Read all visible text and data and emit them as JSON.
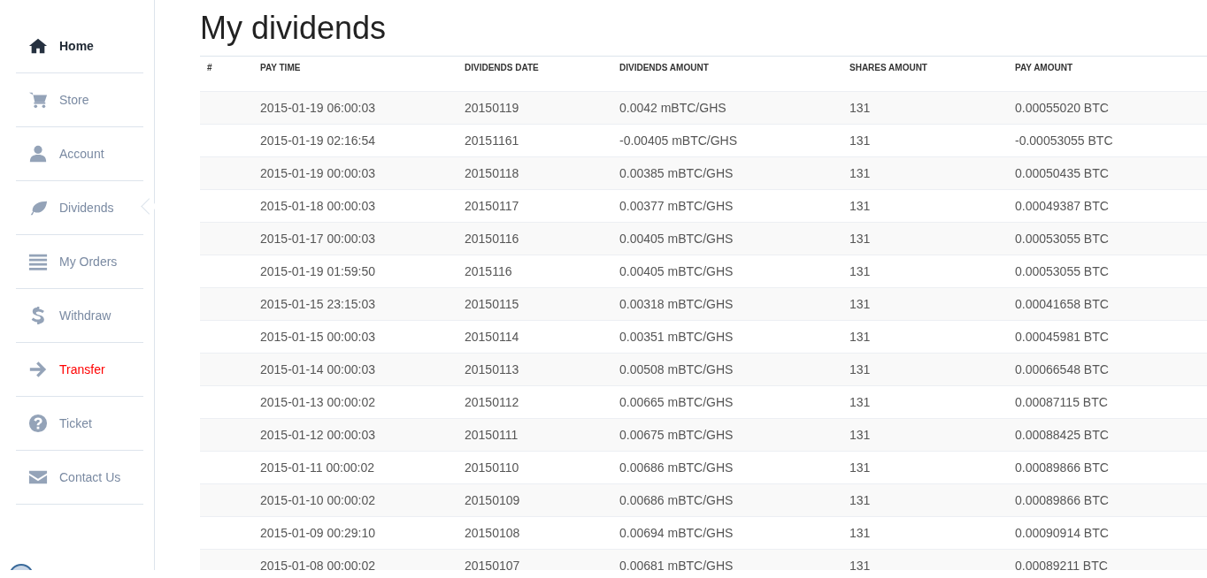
{
  "sidebar": {
    "items": [
      {
        "label": "Home",
        "kind": "strong",
        "selected": false
      },
      {
        "label": "Store",
        "kind": "normal",
        "selected": false
      },
      {
        "label": "Account",
        "kind": "normal",
        "selected": false
      },
      {
        "label": "Dividends",
        "kind": "normal",
        "selected": true
      },
      {
        "label": "My Orders",
        "kind": "normal",
        "selected": false
      },
      {
        "label": "Withdraw",
        "kind": "normal",
        "selected": false
      },
      {
        "label": "Transfer",
        "kind": "alert",
        "selected": false
      },
      {
        "label": "Ticket",
        "kind": "normal",
        "selected": false
      },
      {
        "label": "Contact Us",
        "kind": "normal",
        "selected": false
      }
    ]
  },
  "page": {
    "title": "My dividends"
  },
  "table": {
    "columns": [
      "#",
      "PAY TIME",
      "DIVIDENDS DATE",
      "DIVIDENDS AMOUNT",
      "SHARES AMOUNT",
      "PAY AMOUNT"
    ],
    "rows": [
      [
        "",
        "2015-01-19 06:00:03",
        "20150119",
        "0.0042 mBTC/GHS",
        "131",
        "0.00055020 BTC"
      ],
      [
        "",
        "2015-01-19 02:16:54",
        "20151161",
        "-0.00405 mBTC/GHS",
        "131",
        "-0.00053055 BTC"
      ],
      [
        "",
        "2015-01-19 00:00:03",
        "20150118",
        "0.00385 mBTC/GHS",
        "131",
        "0.00050435 BTC"
      ],
      [
        "",
        "2015-01-18 00:00:03",
        "20150117",
        "0.00377 mBTC/GHS",
        "131",
        "0.00049387 BTC"
      ],
      [
        "",
        "2015-01-17 00:00:03",
        "20150116",
        "0.00405 mBTC/GHS",
        "131",
        "0.00053055 BTC"
      ],
      [
        "",
        "2015-01-19 01:59:50",
        "2015116",
        "0.00405 mBTC/GHS",
        "131",
        "0.00053055 BTC"
      ],
      [
        "",
        "2015-01-15 23:15:03",
        "20150115",
        "0.00318 mBTC/GHS",
        "131",
        "0.00041658 BTC"
      ],
      [
        "",
        "2015-01-15 00:00:03",
        "20150114",
        "0.00351 mBTC/GHS",
        "131",
        "0.00045981 BTC"
      ],
      [
        "",
        "2015-01-14 00:00:03",
        "20150113",
        "0.00508 mBTC/GHS",
        "131",
        "0.00066548 BTC"
      ],
      [
        "",
        "2015-01-13 00:00:02",
        "20150112",
        "0.00665 mBTC/GHS",
        "131",
        "0.00087115 BTC"
      ],
      [
        "",
        "2015-01-12 00:00:03",
        "20150111",
        "0.00675 mBTC/GHS",
        "131",
        "0.00088425 BTC"
      ],
      [
        "",
        "2015-01-11 00:00:02",
        "20150110",
        "0.00686 mBTC/GHS",
        "131",
        "0.00089866 BTC"
      ],
      [
        "",
        "2015-01-10 00:00:02",
        "20150109",
        "0.00686 mBTC/GHS",
        "131",
        "0.00089866 BTC"
      ],
      [
        "",
        "2015-01-09 00:29:10",
        "20150108",
        "0.00694 mBTC/GHS",
        "131",
        "0.00090914 BTC"
      ],
      [
        "",
        "2015-01-08 00:00:02",
        "20150107",
        "0.00681 mBTC/GHS",
        "131",
        "0.00089211 BTC"
      ]
    ]
  }
}
